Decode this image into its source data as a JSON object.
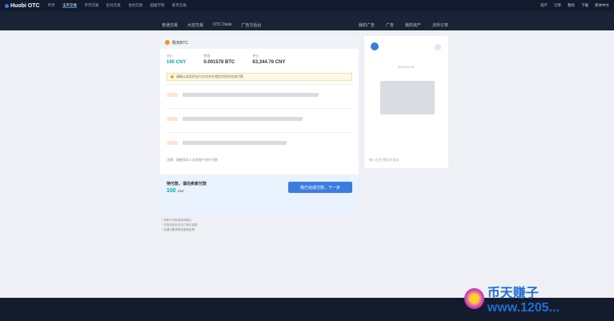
{
  "header": {
    "logo_text": "Huobi OTC",
    "nav": [
      "币币",
      "法币交易",
      "币币交易",
      "杠杆交易",
      "合约交易",
      "超级学院",
      "新币交易"
    ],
    "right": [
      "资产",
      "订单",
      "我的",
      "下载",
      "简体中文"
    ]
  },
  "subnav_left": [
    "普通交易",
    "大宗交易",
    "OTC Desk",
    "广告方后台"
  ],
  "subnav_right": [
    "我的广告",
    "广告",
    "我的资产",
    "法币订单"
  ],
  "order": {
    "title": "购买BTC",
    "stat1_label": "总价",
    "stat1_value": "100 CNY",
    "stat2_label": "数量",
    "stat2_value": "0.001578 BTC",
    "stat3_label": "单价",
    "stat3_value": "63,344.76 CNY",
    "warning": "请确认卖家的支付方式并在规定时间内完成付款",
    "pay_note": "注意：请使用本人实名账户进行付款",
    "confirm_title": "待付款，请向卖家付款",
    "amount": "100",
    "currency": "CNY",
    "button": "我已完成付款，下一步"
  },
  "chat": {
    "date": "2019-11-12",
    "placeholder": "输入信息 按回车发送"
  },
  "notes": [
    "* 商家已付款请及时确认",
    "* 交易完成后可在订单中查看",
    "* 如遇问题请联系客服处理"
  ],
  "watermark": "币天赚子 www.1205..."
}
